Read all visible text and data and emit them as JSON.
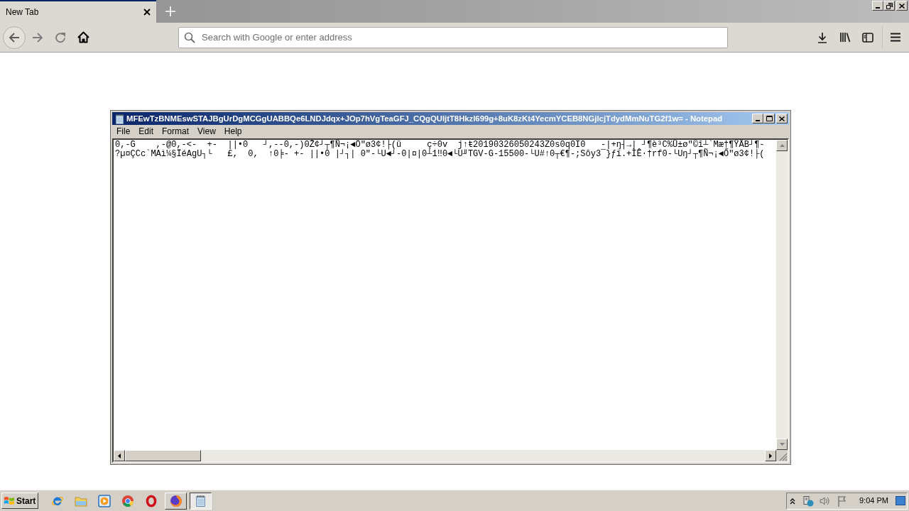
{
  "browser": {
    "tabs": [
      {
        "label": "New Tab",
        "selected": true
      }
    ],
    "address_bar": {
      "placeholder": "Search with Google or enter address"
    }
  },
  "notepad": {
    "title": "MFEwTzBNMEswSTAJBgUrDgMCGgUABBQe6LNDJdqx+JOp7hVgTeaGFJ_CQgQUljtT8Hkzl699g+8uK8zKt4YecmYCEB8NGjlcjTdydMmNuTG2f1w= - Notepad",
    "menu": [
      "File",
      "Edit",
      "Format",
      "View",
      "Help"
    ],
    "lines": [
      "0,-G    ,-@0,-<-  +-  ||•0   ┘,--0,-)0Ž¢┘┬¶Ñ¬¡◄Ő\"ø3¢!├(ü     ç÷0v  j↑ŧ20190326050243Z0s0q0I0   -|+ŋ┤→| ┘¶è³C%Ü±ø\"©î┴`Mæ†¶ŸÂB┘¶-",
      "?µ¤ÇCc`MAì¼§ÏéAgU┐└   £,  0,  ↑0╞- +- ||•0 |┘┐| 0\"-└U◄┘-0|¤|0┴1‼0◄└U╜TGV-G-15500-└U#↑0┬€¶-;Sôy3¯}ƒï.+ÌÊ·†rf0-└Uŋ┘┬¶Ñ¬¡◄Ő\"ø3¢!├("
    ]
  },
  "taskbar": {
    "start": "Start",
    "tasks": [
      {
        "kind": "browser",
        "selected": false
      },
      {
        "kind": "notepad",
        "selected": true
      }
    ],
    "clock": "9:04 PM"
  }
}
